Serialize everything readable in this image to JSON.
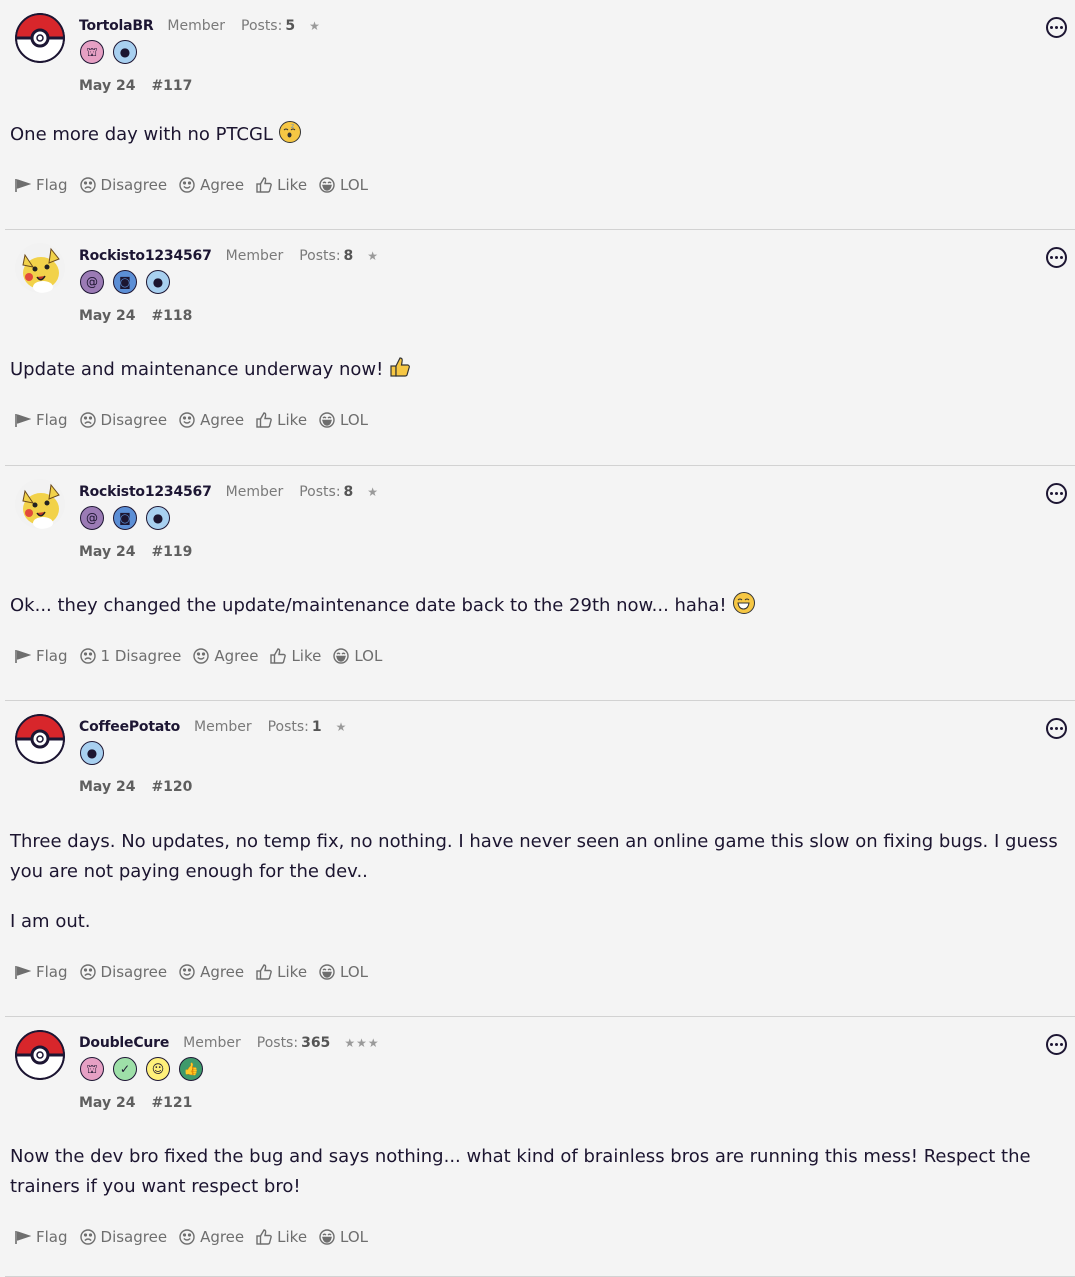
{
  "posts": [
    {
      "username": "TortolaBR",
      "role": "Member",
      "posts_label": "Posts:",
      "posts_count": "5",
      "stars": "★",
      "badges": [
        "cake-badge-icon",
        "chat-badge-icon"
      ],
      "date": "May 24",
      "number": "#117",
      "paragraphs": [
        "One more day with no PTCGL"
      ],
      "emoji": "sleeping-emoji",
      "actions": {
        "flag": "Flag",
        "disagree": "Disagree",
        "agree": "Agree",
        "like": "Like",
        "lol": "LOL"
      }
    },
    {
      "username": "Rockisto1234567",
      "role": "Member",
      "posts_label": "Posts:",
      "posts_count": "8",
      "stars": "★",
      "badges": [
        "contact-badge-icon",
        "camera-badge-icon",
        "chat-badge-icon"
      ],
      "date": "May 24",
      "number": "#118",
      "paragraphs": [
        "Update and maintenance underway now!"
      ],
      "emoji": "thumbs-up-emoji",
      "actions": {
        "flag": "Flag",
        "disagree": "Disagree",
        "agree": "Agree",
        "like": "Like",
        "lol": "LOL"
      }
    },
    {
      "username": "Rockisto1234567",
      "role": "Member",
      "posts_label": "Posts:",
      "posts_count": "8",
      "stars": "★",
      "badges": [
        "contact-badge-icon",
        "camera-badge-icon",
        "chat-badge-icon"
      ],
      "date": "May 24",
      "number": "#119",
      "paragraphs": [
        "Ok... they changed the update/maintenance date back to the 29th now... haha!"
      ],
      "emoji": "grin-emoji",
      "actions": {
        "flag": "Flag",
        "disagree": "1 Disagree",
        "agree": "Agree",
        "like": "Like",
        "lol": "LOL"
      }
    },
    {
      "username": "CoffeePotato",
      "role": "Member",
      "posts_label": "Posts:",
      "posts_count": "1",
      "stars": "★",
      "badges": [
        "chat-badge-icon"
      ],
      "date": "May 24",
      "number": "#120",
      "paragraphs": [
        "Three days. No updates, no temp fix, no nothing. I have never seen an online game this slow on fixing bugs. I guess you are not paying enough for the dev..",
        "I am out."
      ],
      "emoji": "",
      "actions": {
        "flag": "Flag",
        "disagree": "Disagree",
        "agree": "Agree",
        "like": "Like",
        "lol": "LOL"
      }
    },
    {
      "username": "DoubleCure",
      "role": "Member",
      "posts_label": "Posts:",
      "posts_count": "365",
      "stars": "★★★",
      "badges": [
        "cake-badge-icon",
        "check-badge-icon",
        "smile-badge-icon",
        "like-badge-icon"
      ],
      "date": "May 24",
      "number": "#121",
      "paragraphs": [
        "Now the dev bro fixed the bug and says nothing... what kind of brainless bros are running this mess! Respect the trainers if you want respect bro!"
      ],
      "emoji": "",
      "actions": {
        "flag": "Flag",
        "disagree": "Disagree",
        "agree": "Agree",
        "like": "Like",
        "lol": "LOL"
      }
    }
  ],
  "colors": {
    "background": "#f4f4f4",
    "text": "#1c1530",
    "muted": "#7a7a7a",
    "divider": "#d2d2d2",
    "badge_pink": "#e6a0c4",
    "badge_blue": "#a8d0f0",
    "badge_purple": "#9b7bb5",
    "badge_camera": "#5c8fd6",
    "badge_green": "#9ee0a8",
    "badge_yellow": "#fff07a",
    "badge_darkgreen": "#3f9a6b"
  }
}
